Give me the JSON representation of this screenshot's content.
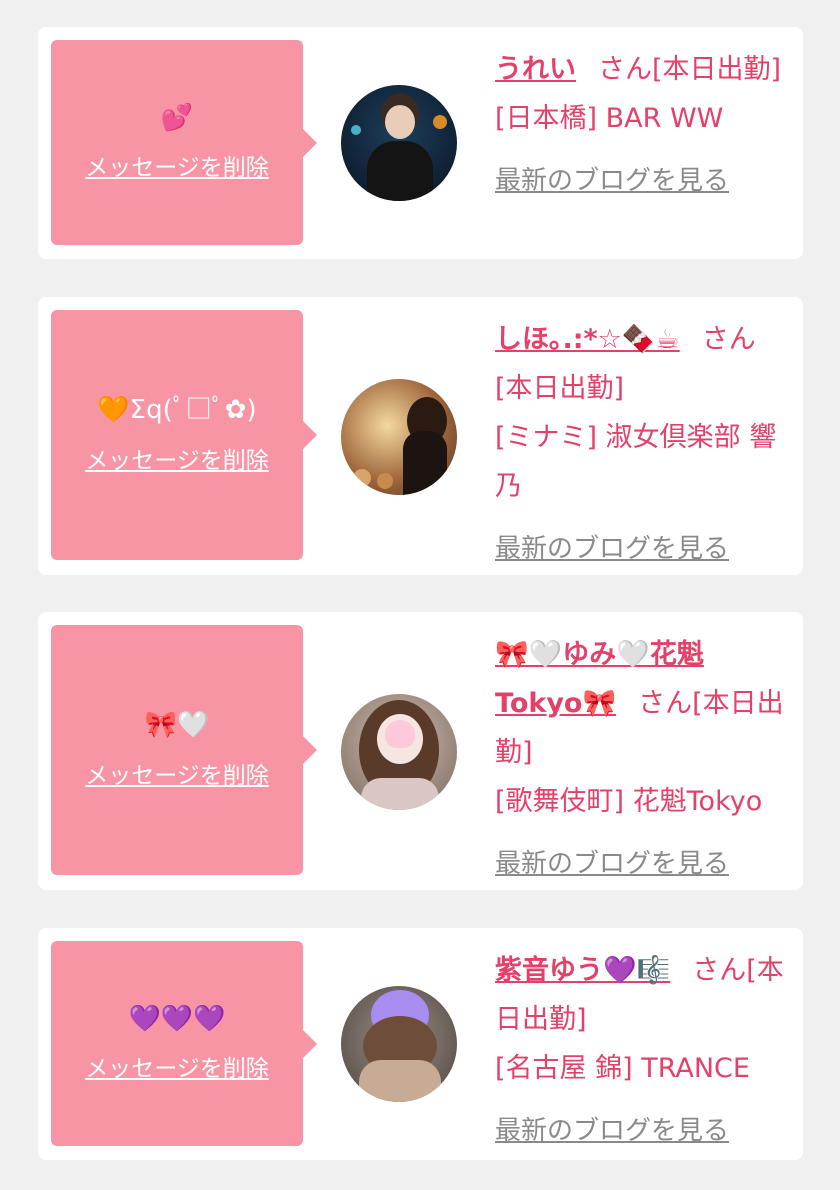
{
  "delete_label": "メッセージを削除",
  "blog_label": "最新のブログを見る",
  "colors": {
    "bubble": "#f895a5",
    "accent": "#e4416a",
    "muted": "#8a8a8a",
    "card": "#ffffff",
    "background": "#f0f0f0"
  },
  "entries": [
    {
      "message": "💕",
      "name": "うれい",
      "suffix": "さん[本日出勤]",
      "area_shop": "[日本橋] BAR WW"
    },
    {
      "message": "🧡Σq(ﾟ□ﾟ✿)",
      "name": "しほ｡.:*☆🍫☕",
      "suffix": "さん[本日出勤]",
      "area_shop": "[ミナミ] 淑女倶楽部 響乃"
    },
    {
      "message": "🎀🤍",
      "name": "🎀🤍ゆみ🤍花魁Tokyo🎀",
      "suffix": "さん[本日出勤]",
      "area_shop": "[歌舞伎町] 花魁Tokyo"
    },
    {
      "message": "💜💜💜",
      "name": "紫音ゆう💜🎼",
      "suffix": "さん[本日出勤]",
      "area_shop": "[名古屋 錦] TRANCE"
    }
  ]
}
